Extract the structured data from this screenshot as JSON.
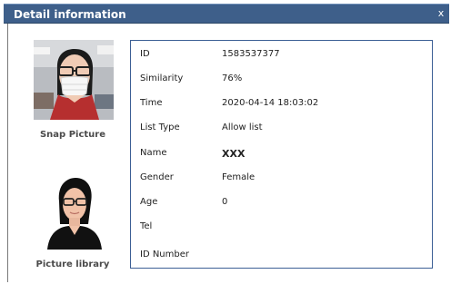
{
  "window": {
    "title": "Detail information",
    "close_label": "x"
  },
  "captions": {
    "snap": "Snap Picture",
    "library": "Picture library"
  },
  "details": [
    {
      "label": "ID",
      "value": "1583537377"
    },
    {
      "label": "Similarity",
      "value": "76%"
    },
    {
      "label": "Time",
      "value": "2020-04-14 18:03:02"
    },
    {
      "label": "List Type",
      "value": "Allow list"
    },
    {
      "label": "Name",
      "value": "XXX"
    },
    {
      "label": "Gender",
      "value": "Female"
    },
    {
      "label": "Age",
      "value": "0"
    },
    {
      "label": "Tel",
      "value": ""
    },
    {
      "label": "ID Number",
      "value": ""
    }
  ],
  "colors": {
    "titlebar": "#3e5f8a",
    "panel_border": "#3c5f95"
  }
}
